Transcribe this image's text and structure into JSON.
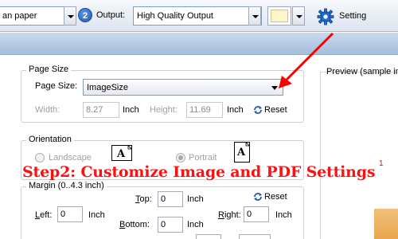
{
  "toolbar": {
    "paper_partial": "an paper",
    "step2": "2",
    "output_label": "Output:",
    "output_value": "High Quality Output",
    "setting_label": "Setting",
    "colors": {
      "accent": "#1f57b8",
      "swatch": "#fff6cc"
    }
  },
  "page_size": {
    "title": "Page Size",
    "label": "Page Size:",
    "value": "ImageSize",
    "width_label": "Width:",
    "width_value": "8.27",
    "width_unit": "Inch",
    "height_label": "Height:",
    "height_value": "11.69",
    "height_unit": "Inch",
    "reset": "Reset"
  },
  "orientation": {
    "title": "Orientation",
    "landscape": "Landscape",
    "portrait": "Portrait",
    "selected": "Portrait",
    "icon_letter": "A"
  },
  "margin": {
    "title": "Margin (0..4.3 inch)",
    "top_label": "Top:",
    "top_value": "0",
    "bottom_label": "Bottom:",
    "bottom_value": "0",
    "left_label": "Left:",
    "left_value": "0",
    "right_label": "Right:",
    "right_value": "0",
    "unit": "Inch",
    "reset": "Reset"
  },
  "preview": {
    "title": "Preview (sample im",
    "page_number": "1"
  },
  "overlay_caption": "Step2: Customize Image and PDF Settings",
  "icons": [
    "dropdown-arrow-icon",
    "gear-icon",
    "reset-icon",
    "landscape-page-icon",
    "portrait-page-icon",
    "red-arrow-icon"
  ]
}
